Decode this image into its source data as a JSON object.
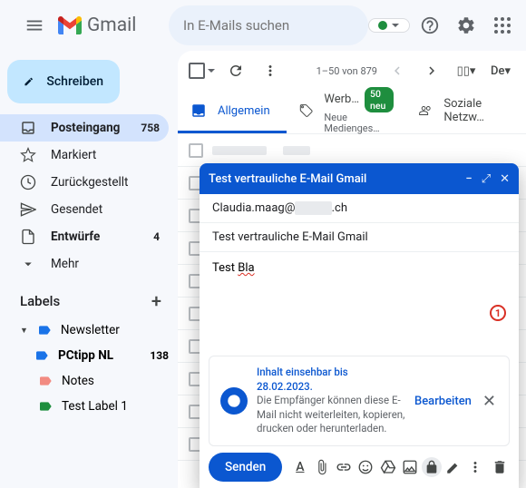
{
  "app": {
    "name": "Gmail"
  },
  "header": {
    "search_placeholder": "In E-Mails suchen"
  },
  "sidebar": {
    "compose_label": "Schreiben",
    "items": [
      {
        "label": "Posteingang",
        "count": "758",
        "icon": "inbox",
        "active": true
      },
      {
        "label": "Markiert",
        "count": "",
        "icon": "star"
      },
      {
        "label": "Zurückgestellt",
        "count": "",
        "icon": "clock"
      },
      {
        "label": "Gesendet",
        "count": "",
        "icon": "send"
      },
      {
        "label": "Entwürfe",
        "count": "4",
        "icon": "draft",
        "bold": true
      },
      {
        "label": "Mehr",
        "count": "",
        "icon": "more"
      }
    ],
    "labels_header": "Labels",
    "labels": [
      {
        "label": "Newsletter",
        "color": "#1a73e8",
        "count": "",
        "expandable": true
      },
      {
        "label": "PCtipp NL",
        "color": "#1a73e8",
        "count": "138",
        "child": true
      },
      {
        "label": "Notes",
        "color": "#f28b82",
        "count": ""
      },
      {
        "label": "Test Label 1",
        "color": "#1e8e3e",
        "count": ""
      }
    ]
  },
  "toolbar": {
    "pagination": "1–50 von 879"
  },
  "tabs": [
    {
      "label": "Allgemein",
      "active": true,
      "icon": "inbox"
    },
    {
      "label": "Werb…",
      "sub": "Neue Medienges…",
      "badge": "50 neu",
      "icon": "tag"
    },
    {
      "label": "Soziale Netzw…",
      "icon": "people"
    }
  ],
  "compose": {
    "title": "Test vertrauliche E-Mail Gmail",
    "to_prefix": "Claudia.maag@",
    "to_redacted": "xxxxx",
    "to_suffix": ".ch",
    "subject": "Test vertrauliche E-Mail Gmail",
    "body_prefix": "Test ",
    "body_misspell": "Bla",
    "confidential": {
      "title": "Inhalt einsehbar bis 28.02.2023.",
      "text": "Die Empfänger können diese E-Mail nicht weiterleiten, kopieren, drucken oder herunterladen.",
      "edit": "Bearbeiten"
    },
    "send_label": "Senden"
  }
}
